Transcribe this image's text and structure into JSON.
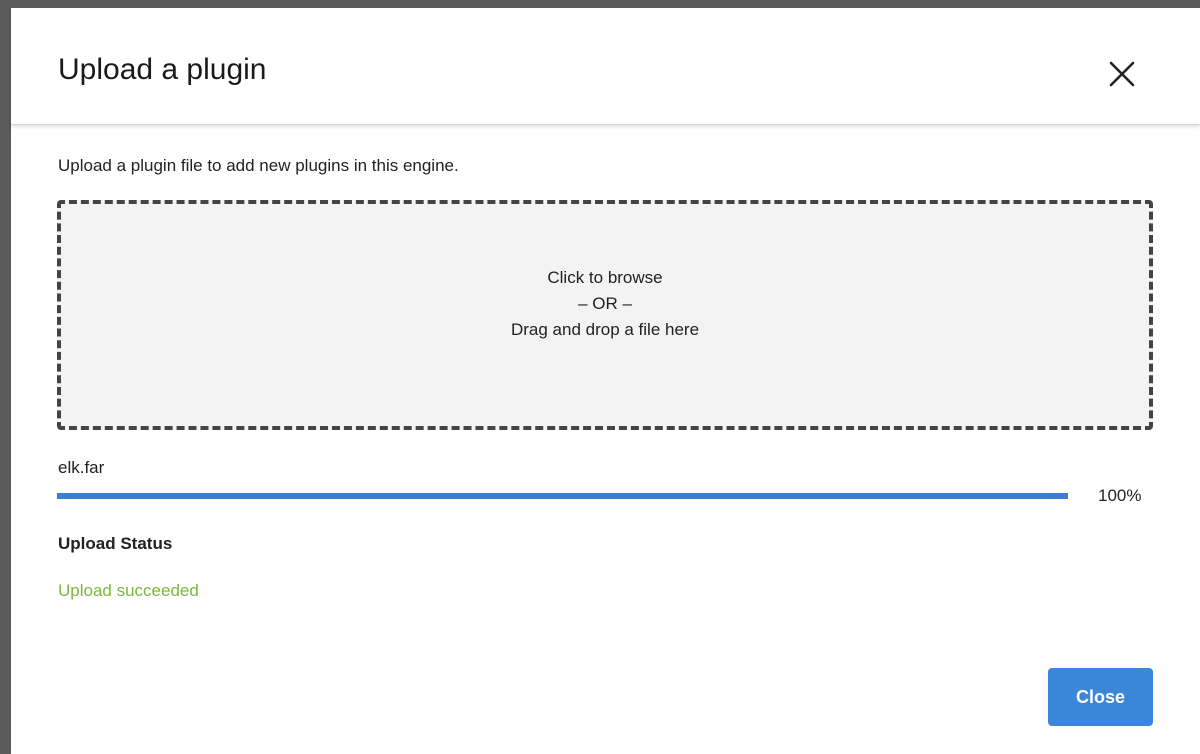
{
  "modal": {
    "title": "Upload a plugin",
    "intro": "Upload a plugin file to add new plugins in this engine."
  },
  "dropzone": {
    "line1": "Click to browse",
    "line2": "– OR –",
    "line3": "Drag and drop a file here"
  },
  "upload": {
    "filename": "elk.far",
    "progress_percent": 100,
    "progress_label": "100%"
  },
  "status": {
    "heading": "Upload Status",
    "message": "Upload succeeded",
    "message_color": "#7ab83a"
  },
  "footer": {
    "close_label": "Close"
  },
  "colors": {
    "accent": "#3a87d9",
    "progress": "#3a7fd4",
    "success": "#7ab83a"
  },
  "icons": {
    "close": "close-icon"
  }
}
